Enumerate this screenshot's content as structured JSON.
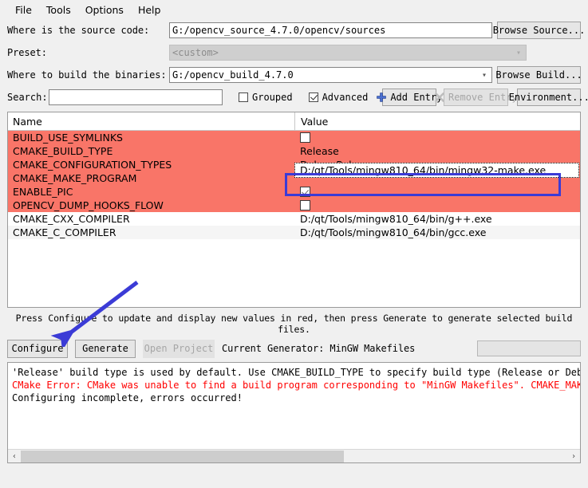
{
  "menu": {
    "items": [
      {
        "label": "File",
        "name": "menu-file"
      },
      {
        "label": "Tools",
        "name": "menu-tools"
      },
      {
        "label": "Options",
        "name": "menu-options"
      },
      {
        "label": "Help",
        "name": "menu-help"
      }
    ]
  },
  "form": {
    "source_label": "Where is the source code:",
    "source_value": "G:/opencv_source_4.7.0/opencv/sources",
    "browse_source_label": "Browse Source...",
    "preset_label": "Preset:",
    "preset_value": "<custom>",
    "build_label": "Where to build the binaries:",
    "build_value": "G:/opencv_build_4.7.0",
    "browse_build_label": "Browse Build..."
  },
  "toolbar": {
    "search_label": "Search:",
    "search_value": "",
    "search_placeholder": "",
    "grouped_label": "Grouped",
    "grouped_checked": false,
    "advanced_label": "Advanced",
    "advanced_checked": true,
    "add_entry_label": "Add Entry",
    "remove_entry_label": "Remove Entry",
    "environment_label": "Environment..."
  },
  "table": {
    "columns": [
      "Name",
      "Value"
    ],
    "rows": [
      {
        "name": "BUILD_USE_SYMLINKS",
        "value": "",
        "type": "checkbox",
        "checked": false,
        "modified": true
      },
      {
        "name": "CMAKE_BUILD_TYPE",
        "value": "Release",
        "type": "text",
        "modified": true
      },
      {
        "name": "CMAKE_CONFIGURATION_TYPES",
        "value": "Debug;Release",
        "type": "text",
        "modified": true
      },
      {
        "name": "CMAKE_MAKE_PROGRAM",
        "value": "D:/qt/Tools/mingw810_64/bin/mingw32-make.exe",
        "type": "editing",
        "modified": true
      },
      {
        "name": "ENABLE_PIC",
        "value": "",
        "type": "checkbox",
        "checked": true,
        "modified": true
      },
      {
        "name": "OPENCV_DUMP_HOOKS_FLOW",
        "value": "",
        "type": "checkbox",
        "checked": false,
        "modified": true
      },
      {
        "name": "CMAKE_CXX_COMPILER",
        "value": "D:/qt/Tools/mingw810_64/bin/g++.exe",
        "type": "text",
        "modified": false
      },
      {
        "name": "CMAKE_C_COMPILER",
        "value": "D:/qt/Tools/mingw810_64/bin/gcc.exe",
        "type": "text",
        "modified": false
      }
    ],
    "editing_value": "D:/qt/Tools/mingw810_64/bin/mingw32-make.exe"
  },
  "hint": "Press Configure to update and display new values in red, then press Generate to generate selected build files.",
  "actions": {
    "configure_label": "Configure",
    "generate_label": "Generate",
    "open_project_label": "Open Project",
    "current_generator": "Current Generator: MinGW Makefiles"
  },
  "log": {
    "lines": [
      {
        "text": "'Release' build type is used by default. Use CMAKE_BUILD_TYPE to specify build type (Release or Debug)",
        "error": false
      },
      {
        "text": "CMake Error: CMake was unable to find a build program corresponding to \"MinGW Makefiles\".  CMAKE_MAKE_",
        "error": true
      },
      {
        "text": "Configuring incomplete, errors occurred!",
        "error": false
      }
    ],
    "scroll_left_icon": "‹",
    "scroll_right_icon": "›"
  },
  "colors": {
    "modified_row": "#f97568",
    "error_text": "#ff0000",
    "annotation": "#3b3bd6",
    "accent": "#3b3bd6"
  }
}
